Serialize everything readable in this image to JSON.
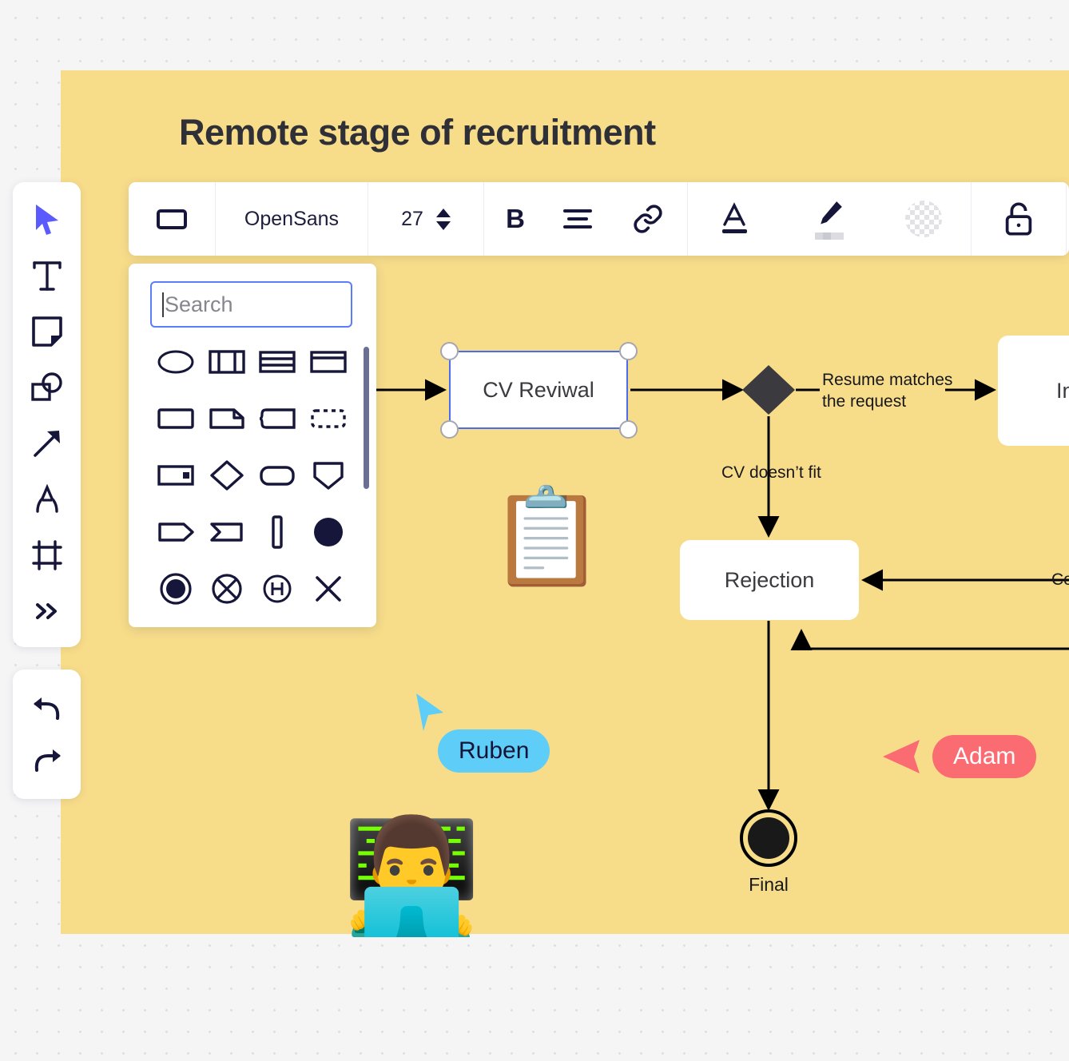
{
  "board": {
    "title": "Remote stage of recruitment",
    "background_color": "#f7dd8a",
    "canvas_color": "#f5f5f6"
  },
  "tool_rail": {
    "items": [
      {
        "name": "select-tool",
        "icon": "cursor-icon",
        "label": "Select"
      },
      {
        "name": "text-tool",
        "icon": "text-icon",
        "label": "Text"
      },
      {
        "name": "sticky-note-tool",
        "icon": "sticky-note-icon",
        "label": "Sticky note"
      },
      {
        "name": "shapes-tool",
        "icon": "shapes-icon",
        "label": "Shapes"
      },
      {
        "name": "arrow-tool",
        "icon": "arrow-icon",
        "label": "Arrow"
      },
      {
        "name": "pen-tool",
        "icon": "pen-curve-icon",
        "label": "Pen"
      },
      {
        "name": "frame-tool",
        "icon": "frame-icon",
        "label": "Frame"
      },
      {
        "name": "more-tools",
        "icon": "chevrons-right-icon",
        "label": "More tools"
      }
    ],
    "history": [
      {
        "name": "undo-button",
        "icon": "undo-icon",
        "label": "Undo"
      },
      {
        "name": "redo-button",
        "icon": "redo-icon",
        "label": "Redo"
      }
    ]
  },
  "format_toolbar": {
    "shape_icon": "rectangle-icon",
    "font_family": "OpenSans",
    "font_size": "27",
    "bold_label": "B",
    "align_icon": "align-icon",
    "link_icon": "link-icon",
    "text_color_icon": "text-color-icon",
    "highlighter_icon": "highlighter-icon",
    "fill_color_icon": "transparent-swatch-icon",
    "lock_icon": "unlock-icon",
    "more_icon": "more-horizontal-icon"
  },
  "shape_panel": {
    "search_placeholder": "Search",
    "search_value": "",
    "shapes": [
      {
        "name": "shape-ellipse",
        "label": "Ellipse"
      },
      {
        "name": "shape-columns",
        "label": "Columns"
      },
      {
        "name": "shape-table-rows",
        "label": "Table rows"
      },
      {
        "name": "shape-header-box",
        "label": "Header box"
      },
      {
        "name": "shape-rectangle",
        "label": "Rectangle"
      },
      {
        "name": "shape-folded-corner",
        "label": "Folded corner"
      },
      {
        "name": "shape-bracket-box",
        "label": "Bracket box"
      },
      {
        "name": "shape-dashed-rectangle",
        "label": "Dashed rectangle"
      },
      {
        "name": "shape-note-marker",
        "label": "Note marker"
      },
      {
        "name": "shape-diamond",
        "label": "Diamond"
      },
      {
        "name": "shape-rounded-rectangle",
        "label": "Rounded rectangle"
      },
      {
        "name": "shape-shield",
        "label": "Shield"
      },
      {
        "name": "shape-tag",
        "label": "Tag"
      },
      {
        "name": "shape-chevron-banner",
        "label": "Chevron banner"
      },
      {
        "name": "shape-vertical-bar",
        "label": "Vertical bar"
      },
      {
        "name": "shape-filled-circle",
        "label": "Filled circle"
      },
      {
        "name": "shape-end-state",
        "label": "End state"
      },
      {
        "name": "shape-crossed-circle",
        "label": "Crossed circle"
      },
      {
        "name": "shape-circle-h",
        "label": "History state"
      },
      {
        "name": "shape-cross",
        "label": "Cross"
      }
    ]
  },
  "diagram": {
    "nodes": [
      {
        "name": "node-cv-review",
        "label": "CV Reviwal",
        "selected": true
      },
      {
        "name": "node-rejection",
        "label": "Rejection",
        "selected": false
      },
      {
        "name": "node-invite",
        "label": "Invite\nin",
        "selected": false
      },
      {
        "name": "node-final",
        "label": "Final",
        "selected": false
      }
    ],
    "edge_labels": [
      {
        "name": "edge-label-resume-matches",
        "text": "Resume matches\nthe request"
      },
      {
        "name": "edge-label-cv-doesnt-fit",
        "text": "CV doesn’t fit"
      },
      {
        "name": "edge-label-co",
        "text": "Co"
      }
    ],
    "final_label": "Final"
  },
  "stickers": [
    {
      "name": "clipboard-sticker",
      "glyph": "📋"
    },
    {
      "name": "technologist-sticker",
      "glyph": "👨‍💻"
    }
  ],
  "collaborators": [
    {
      "name": "cursor-ruben",
      "label": "Ruben",
      "color": "#5ecdf7",
      "text_color": "#141436"
    },
    {
      "name": "cursor-adam",
      "label": "Adam",
      "color": "#fb6b72",
      "text_color": "#ffffff"
    }
  ]
}
